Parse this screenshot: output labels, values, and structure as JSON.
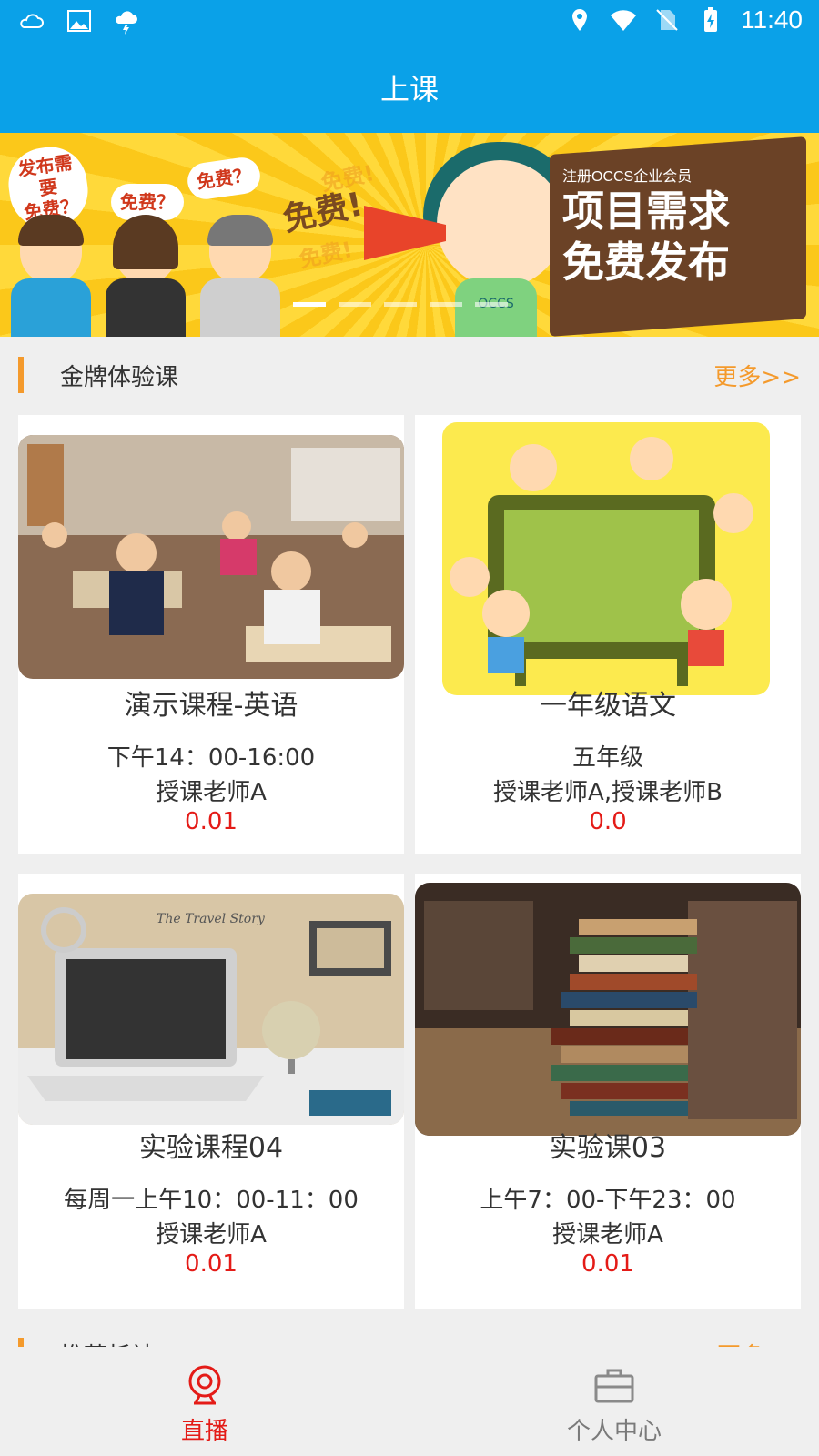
{
  "status_bar": {
    "time": "11:40",
    "left_icons": [
      "weather-icon",
      "image-icon",
      "thunderstorm-icon"
    ],
    "right_icons": [
      "location-icon",
      "wifi-icon",
      "no-sim-icon",
      "battery-charging-icon"
    ]
  },
  "header": {
    "title": "上课"
  },
  "banner": {
    "bubble1": "发布需要\n免费？",
    "bubble2": "免费？",
    "bubble3": "免费？",
    "shout_main": "免费!",
    "shout_top": "免费!",
    "shout_bottom": "免费!",
    "subhead": "注册OCCS企业会员",
    "headline_line1": "项目需求",
    "headline_line2": "免费发布",
    "shirt_text": "OCCS",
    "page_count": 5,
    "active_page": 1
  },
  "section_gold": {
    "title": "金牌体验课",
    "more": "更多>>"
  },
  "courses": [
    {
      "name": "演示课程-英语",
      "time": "下午14：00-16:00",
      "teacher": "授课老师A",
      "price": "0.01"
    },
    {
      "name": "一年级语文",
      "time": "五年级",
      "teacher": "授课老师A,授课老师B",
      "price": "0.0"
    },
    {
      "name": "实验课程04",
      "time": "每周一上午10：00-11：00",
      "teacher": "授课老师A",
      "price": "0.01"
    },
    {
      "name": "实验课03",
      "time": "上午7：00-下午23：00",
      "teacher": "授课老师A",
      "price": "0.01"
    }
  ],
  "section_recommend": {
    "title": "推荐析社",
    "more": "更多"
  },
  "tabs": [
    {
      "label": "直播",
      "icon": "webcam-icon",
      "active": true
    },
    {
      "label": "个人中心",
      "icon": "briefcase-icon",
      "active": false
    }
  ],
  "colors": {
    "primary": "#0aa1e8",
    "accent": "#f49a2c",
    "price": "#e41b17"
  }
}
